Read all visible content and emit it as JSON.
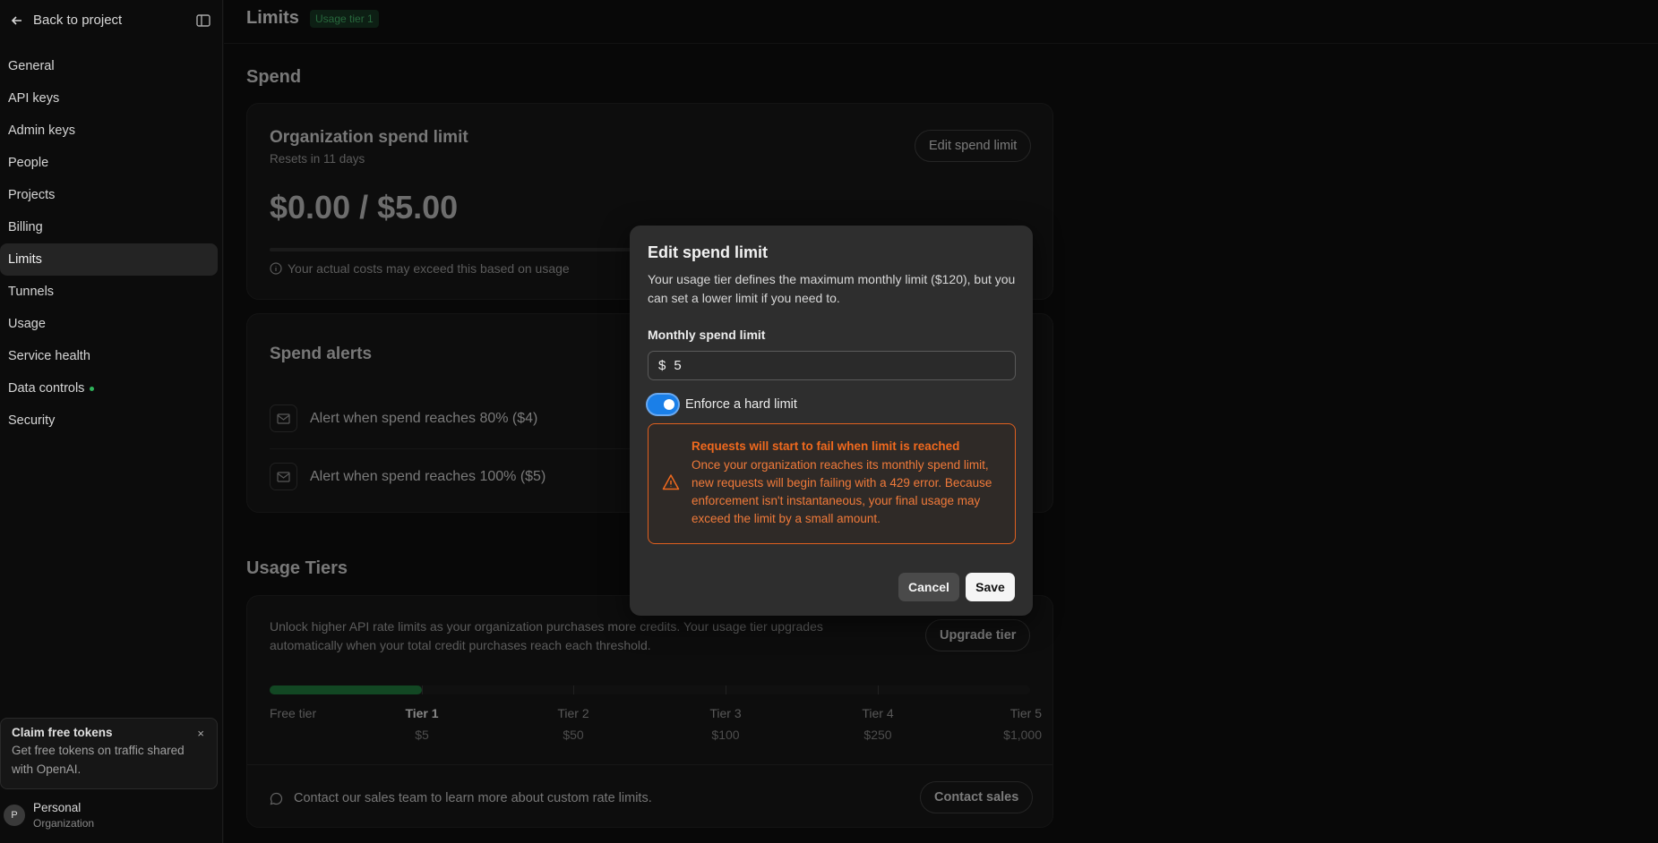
{
  "sidebar": {
    "back_label": "Back to project",
    "items": [
      {
        "label": "General"
      },
      {
        "label": "API keys"
      },
      {
        "label": "Admin keys"
      },
      {
        "label": "People"
      },
      {
        "label": "Projects"
      },
      {
        "label": "Billing"
      },
      {
        "label": "Limits"
      },
      {
        "label": "Tunnels"
      },
      {
        "label": "Usage"
      },
      {
        "label": "Service health"
      },
      {
        "label": "Data controls"
      },
      {
        "label": "Security"
      }
    ],
    "active_item": "Limits",
    "claim": {
      "title": "Claim free tokens",
      "text": "Get free tokens on traffic shared with OpenAI.",
      "close": "×"
    },
    "org": {
      "initial": "P",
      "name": "Personal",
      "type": "Organization"
    }
  },
  "header": {
    "title": "Limits",
    "badge": "Usage tier 1"
  },
  "spend": {
    "heading": "Spend",
    "card_title": "Organization spend limit",
    "resets": "Resets in 11 days",
    "edit_button": "Edit spend limit",
    "amount": "$0.00 / $5.00",
    "note": "Your actual costs may exceed this based on usage"
  },
  "alerts": {
    "heading": "Spend alerts",
    "items": [
      {
        "label": "Alert when spend reaches 80% ($4)"
      },
      {
        "label": "Alert when spend reaches 100% ($5)"
      }
    ]
  },
  "tiers": {
    "heading": "Usage Tiers",
    "description": "Unlock higher API rate limits as your organization purchases more credits. Your usage tier upgrades automatically when your total credit purchases reach each threshold.",
    "upgrade_button": "Upgrade tier",
    "progress_fraction": 0.2,
    "levels": [
      {
        "name": "Free tier",
        "price": ""
      },
      {
        "name": "Tier 1",
        "price": "$5"
      },
      {
        "name": "Tier 2",
        "price": "$50"
      },
      {
        "name": "Tier 3",
        "price": "$100"
      },
      {
        "name": "Tier 4",
        "price": "$250"
      },
      {
        "name": "Tier 5",
        "price": "$1,000"
      }
    ],
    "contact_text": "Contact our sales team to learn more about custom rate limits.",
    "contact_button": "Contact sales"
  },
  "modal": {
    "title": "Edit spend limit",
    "description": "Your usage tier defines the maximum monthly limit ($120), but you can set a lower limit if you need to.",
    "field_label": "Monthly spend limit",
    "currency": "$",
    "value": "5",
    "toggle_label": "Enforce a hard limit",
    "toggle_on": true,
    "warning_title": "Requests will start to fail when limit is reached",
    "warning_text": "Once your organization reaches its monthly spend limit, new requests will begin failing with a 429 error. Because enforcement isn't instantaneous, your final usage may exceed the limit by a small amount.",
    "cancel": "Cancel",
    "save": "Save"
  },
  "colors": {
    "accent_blue": "#1a7fe8",
    "warning_orange": "#f0691e",
    "tier_green": "#1c6e37",
    "badge_green": "#3d9e5c"
  }
}
